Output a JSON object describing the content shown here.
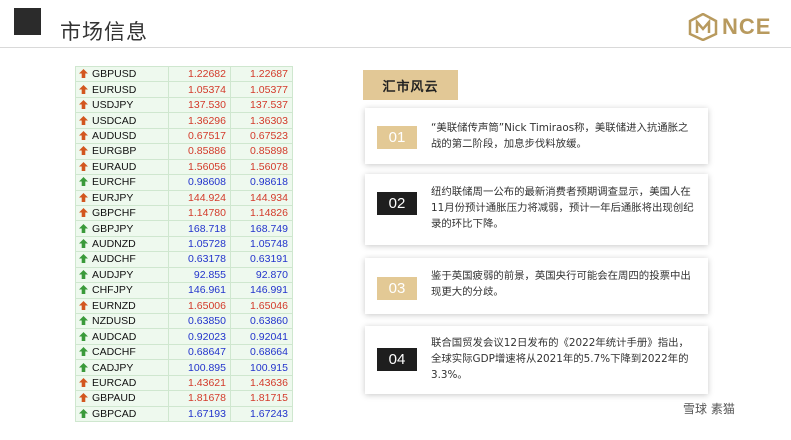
{
  "header": {
    "title": "市场信息"
  },
  "logo": {
    "text": "NCE"
  },
  "colors": {
    "gold": "#b89a5e",
    "up": "#d33a2a",
    "down": "#2233cc"
  },
  "quotes": [
    {
      "symbol": "GBPUSD",
      "bid": "1.22682",
      "ask": "1.22687",
      "dir": "up"
    },
    {
      "symbol": "EURUSD",
      "bid": "1.05374",
      "ask": "1.05377",
      "dir": "up"
    },
    {
      "symbol": "USDJPY",
      "bid": "137.530",
      "ask": "137.537",
      "dir": "up"
    },
    {
      "symbol": "USDCAD",
      "bid": "1.36296",
      "ask": "1.36303",
      "dir": "up"
    },
    {
      "symbol": "AUDUSD",
      "bid": "0.67517",
      "ask": "0.67523",
      "dir": "up"
    },
    {
      "symbol": "EURGBP",
      "bid": "0.85886",
      "ask": "0.85898",
      "dir": "up"
    },
    {
      "symbol": "EURAUD",
      "bid": "1.56056",
      "ask": "1.56078",
      "dir": "up"
    },
    {
      "symbol": "EURCHF",
      "bid": "0.98608",
      "ask": "0.98618",
      "dir": "down"
    },
    {
      "symbol": "EURJPY",
      "bid": "144.924",
      "ask": "144.934",
      "dir": "up"
    },
    {
      "symbol": "GBPCHF",
      "bid": "1.14780",
      "ask": "1.14826",
      "dir": "up"
    },
    {
      "symbol": "GBPJPY",
      "bid": "168.718",
      "ask": "168.749",
      "dir": "down"
    },
    {
      "symbol": "AUDNZD",
      "bid": "1.05728",
      "ask": "1.05748",
      "dir": "down"
    },
    {
      "symbol": "AUDCHF",
      "bid": "0.63178",
      "ask": "0.63191",
      "dir": "down"
    },
    {
      "symbol": "AUDJPY",
      "bid": "92.855",
      "ask": "92.870",
      "dir": "down"
    },
    {
      "symbol": "CHFJPY",
      "bid": "146.961",
      "ask": "146.991",
      "dir": "down"
    },
    {
      "symbol": "EURNZD",
      "bid": "1.65006",
      "ask": "1.65046",
      "dir": "up"
    },
    {
      "symbol": "NZDUSD",
      "bid": "0.63850",
      "ask": "0.63860",
      "dir": "down"
    },
    {
      "symbol": "AUDCAD",
      "bid": "0.92023",
      "ask": "0.92041",
      "dir": "down"
    },
    {
      "symbol": "CADCHF",
      "bid": "0.68647",
      "ask": "0.68664",
      "dir": "down"
    },
    {
      "symbol": "CADJPY",
      "bid": "100.895",
      "ask": "100.915",
      "dir": "down"
    },
    {
      "symbol": "EURCAD",
      "bid": "1.43621",
      "ask": "1.43636",
      "dir": "up"
    },
    {
      "symbol": "GBPAUD",
      "bid": "1.81678",
      "ask": "1.81715",
      "dir": "up"
    },
    {
      "symbol": "GBPCAD",
      "bid": "1.67193",
      "ask": "1.67243",
      "dir": "down"
    }
  ],
  "news": {
    "section_label": "汇市风云",
    "items": [
      {
        "num": "01",
        "text": "“美联储传声筒”Nick Timiraos称，美联储进入抗通胀之战的第二阶段，加息步伐料放缓。"
      },
      {
        "num": "02",
        "text": "纽约联储周一公布的最新消费者预期调查显示，美国人在11月份预计通胀压力将减弱，预计一年后通胀将出现创纪录的环比下降。"
      },
      {
        "num": "03",
        "text": "鉴于英国疲弱的前景，英国央行可能会在周四的投票中出现更大的分歧。"
      },
      {
        "num": "04",
        "text": "联合国贸发会议12日发布的《2022年统计手册》指出，全球实际GDP增速将从2021年的5.7%下降到2022年的3.3%。"
      }
    ]
  },
  "watermark": {
    "text": "雪球 素猫"
  }
}
